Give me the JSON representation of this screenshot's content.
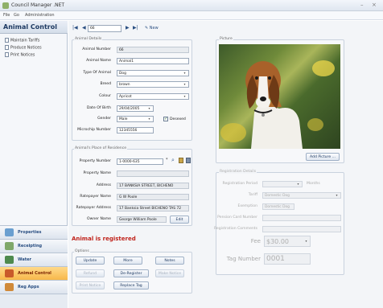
{
  "window": {
    "title": "Council Manager .NET",
    "controls": [
      "–",
      "×"
    ]
  },
  "menu": [
    "File",
    "Go",
    "Administration"
  ],
  "sidebar": {
    "title": "Animal Control",
    "items": [
      "Maintain Tariffs",
      "Produce Notices",
      "Print Notices"
    ],
    "nav": [
      "Properties",
      "Receipting",
      "Water",
      "Animal Control",
      "Reg Apps"
    ]
  },
  "toolbar": {
    "first": "|◀",
    "prev": "◀",
    "record": "66",
    "next": "▶",
    "last": "▶|",
    "new_label": "New"
  },
  "animal_details": {
    "legend": "Animal Details",
    "labels": [
      "Animal Number",
      "Animal Name",
      "Type Of Animal",
      "Breed",
      "Colour",
      "Date Of Birth",
      "Gender",
      "Microchip Number"
    ],
    "values": {
      "animal_number": "66",
      "animal_name": "Animal1",
      "type": "Dog",
      "breed": "brown",
      "colour": "Apricot",
      "dob": "29/04/2005",
      "gender": "Male",
      "microchip": "12345556"
    },
    "desexed_label": "Desexed"
  },
  "residence": {
    "legend": "Animal's Place of Residence",
    "labels": [
      "Property Number",
      "Property Name",
      "Address",
      "Ratepayer Name",
      "Ratepayer Address",
      "Owner Name"
    ],
    "values": {
      "property_number": "1-0000-635",
      "property_name": "",
      "address": "17 BANKSIA STREET, BICHENO",
      "ratepayer_name": "G W Poole",
      "ratepayer_address": "17 Banksia Street BICHENO  TAS  72",
      "owner_name": "George William Poole"
    },
    "edit_label": "Edit"
  },
  "status": "Animal is registered",
  "options": {
    "legend": "Options",
    "buttons": [
      "Update",
      "More",
      "Notes",
      "Refund",
      "De-Register",
      "Make Notice",
      "Print Notice",
      "Replace Tag"
    ]
  },
  "picture": {
    "legend": "Picture",
    "add_label": "Add Picture ..."
  },
  "registration": {
    "legend": "Registration Details",
    "labels": [
      "Registration Period",
      "Tariff",
      "Exemption",
      "Pension Card Number",
      "Registration Comments"
    ],
    "period_unit": "Months",
    "tariff_value": "Domestic Dog",
    "exemption_value": "Domestic Dog",
    "fee_label": "Fee",
    "fee_value": "$30.00",
    "tag_label": "Tag Number",
    "tag_value": "0001"
  }
}
